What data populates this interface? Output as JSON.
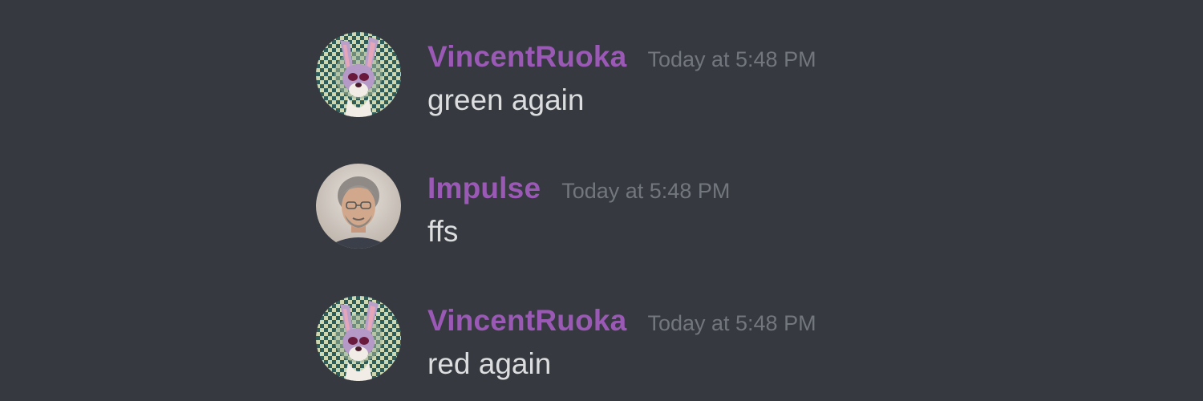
{
  "messages": [
    {
      "username": "VincentRuoka",
      "timestamp": "Today at 5:48 PM",
      "content": "green again",
      "avatar_icon": "cartoon-rabbit-avatar"
    },
    {
      "username": "Impulse",
      "timestamp": "Today at 5:48 PM",
      "content": "ffs",
      "avatar_icon": "man-photo-avatar"
    },
    {
      "username": "VincentRuoka",
      "timestamp": "Today at 5:48 PM",
      "content": "red again",
      "avatar_icon": "cartoon-rabbit-avatar"
    }
  ],
  "colors": {
    "background": "#36393f",
    "username": "#9b59b6",
    "timestamp": "#72767d",
    "message_text": "#dcddde"
  }
}
